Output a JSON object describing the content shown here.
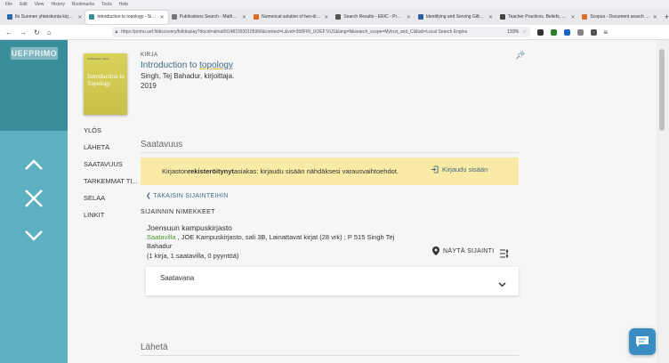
{
  "browser": {
    "menu": [
      "File",
      "Edit",
      "View",
      "History",
      "Bookmarks",
      "Tools",
      "Help"
    ],
    "tabs": [
      {
        "title": "Ilo Suomen yhteiskunta kirjoissa",
        "color": "#2a6aa8",
        "active": false
      },
      {
        "title": "Introduction to topology - Singh",
        "color": "#3a8d9b",
        "active": true
      },
      {
        "title": "Publications Search - MathSciNet",
        "color": "#777777",
        "active": false
      },
      {
        "title": "Numerical solution of two-dimensional",
        "color": "#e06b2b",
        "active": false
      },
      {
        "title": "Search Results - ERIC - ProQuest",
        "color": "#555555",
        "active": false
      },
      {
        "title": "Identifying and Serving Gifted and",
        "color": "#2e5fa1",
        "active": false
      },
      {
        "title": "Teacher Practices, Beliefs, and",
        "color": "#444444",
        "active": false
      },
      {
        "title": "Scopus - Document search results",
        "color": "#e06b2b",
        "active": false
      }
    ],
    "url": "https://primo.uef.fi/discovery/fulldisplay?docid=alma9914819930105966&context=L&vid=358FIN_UOEF:VU1&lang=fi&search_scope=MyInst_and_CI&tab=Local Search Engine",
    "zoom": "133%"
  },
  "sidebar": {
    "logo": "UEFPRIMO",
    "up_label": "Ylös",
    "close_label": "Sulje",
    "down_label": "Alas"
  },
  "record": {
    "type": "KIRJA",
    "title_plain": "Introduction to ",
    "title_highlight": "topology",
    "author": "Singh, Tej Bahadur, kirjoittaja.",
    "year": "2019",
    "cover_author": "Tej Bahadur Singh",
    "cover_title": "Introduction to Topology"
  },
  "sidenav": [
    "YLÖS",
    "LÄHETÄ",
    "SAATAVUUS",
    "TARKEMMAT TI...",
    "SELAA",
    "LINKIT"
  ],
  "availability": {
    "heading": "Saatavuus",
    "notice_prefix": "Kirjaston ",
    "notice_bold": "rekisteröitynyt",
    "notice_suffix": " asiakas: kirjaudu sisään nähdäksesi varausvaihtoehdot.",
    "login_label": "Kirjaudu sisään",
    "back_label": "TAKAISIN SIJAINTEIHIN",
    "locations_heading": "SIJAINNIN NIMEKKEET",
    "library_name": "Joensuun kampuskirjasto",
    "status": "Saatavilla",
    "location_detail": " , JOE Kampuskirjasto, sali 3B, Lainattavat kirjat (28 vrk) ; P 515 Singh Tej Bahadur",
    "counts": "(1 kirja, 1 saatavilla, 0 pyyntöä)",
    "show_location": "NÄYTÄ SIJAINTI",
    "card_label": "Saatavana"
  },
  "next_section": "Lähetä"
}
